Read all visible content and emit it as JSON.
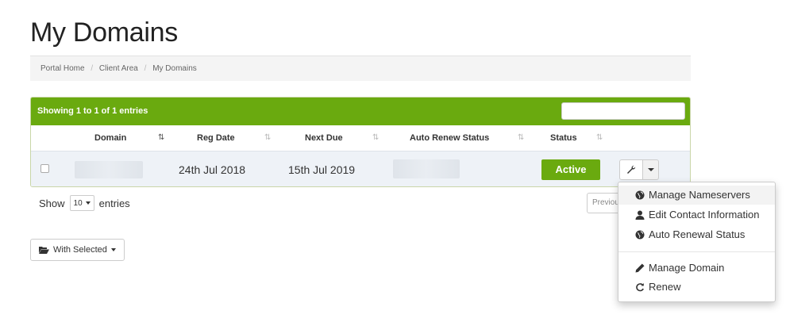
{
  "page": {
    "title": "My Domains"
  },
  "breadcrumb": {
    "items": [
      "Portal Home",
      "Client Area",
      "My Domains"
    ],
    "separator": "/"
  },
  "table": {
    "showing_text": "Showing 1 to 1 of 1 entries",
    "header_color": "#6aaa0f",
    "columns": [
      "Domain",
      "Reg Date",
      "Next Due",
      "Auto Renew Status",
      "Status"
    ],
    "sorted_column": "Domain",
    "rows": [
      {
        "domain": "",
        "reg_date": "24th Jul 2018",
        "next_due": "15th Jul 2019",
        "auto_renew_status": "",
        "status": "Active"
      }
    ]
  },
  "length": {
    "prefix": "Show",
    "value": "10",
    "suffix": "entries"
  },
  "pagination": {
    "previous_label": "Previous"
  },
  "bulk": {
    "with_selected_label": "With Selected"
  },
  "dropdown": {
    "items": [
      {
        "label": "Manage Nameservers",
        "icon": "globe-icon"
      },
      {
        "label": "Edit Contact Information",
        "icon": "user-icon"
      },
      {
        "label": "Auto Renewal Status",
        "icon": "globe-icon"
      },
      {
        "label": "Manage Domain",
        "icon": "pencil-icon"
      },
      {
        "label": "Renew",
        "icon": "refresh-icon"
      }
    ]
  },
  "colors": {
    "accent": "#6aaa0f",
    "row_bg": "#eef2f7"
  }
}
